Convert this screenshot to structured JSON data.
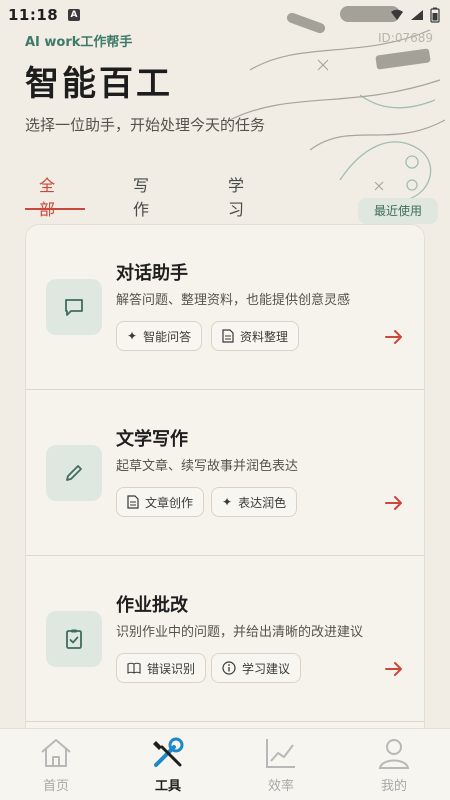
{
  "status_bar": {
    "time": "11:18",
    "a_icon": "A"
  },
  "app_tag": "AI work工作帮手",
  "device_id": "ID:07689",
  "title": "智能百工",
  "subtitle": "选择一位助手，开始处理今天的任务",
  "tabs": [
    {
      "label": "全部",
      "active": true
    },
    {
      "label": "写作",
      "active": false
    },
    {
      "label": "学习",
      "active": false
    }
  ],
  "cards": [
    {
      "icon": "chat-icon",
      "title": "对话助手",
      "desc": "解答问题、整理资料，也能提供创意灵感",
      "chips": [
        {
          "icon": "sparkle-icon",
          "label": "智能问答"
        },
        {
          "icon": "document-icon",
          "label": "资料整理"
        }
      ],
      "badge": ""
    },
    {
      "icon": "pencil-icon",
      "title": "文学写作",
      "desc": "起草文章、续写故事并润色表达",
      "chips": [
        {
          "icon": "document-icon",
          "label": "文章创作"
        },
        {
          "icon": "sparkle-icon",
          "label": "表达润色"
        }
      ],
      "badge": "最近使用"
    },
    {
      "icon": "clipboard-check-icon",
      "title": "作业批改",
      "desc": "识别作业中的问题，并给出清晰的改进建议",
      "chips": [
        {
          "icon": "book-icon",
          "label": "错误识别"
        },
        {
          "icon": "info-icon",
          "label": "学习建议"
        }
      ],
      "badge": ""
    }
  ],
  "bottom_nav": [
    {
      "icon": "home-icon",
      "label": "首页",
      "active": false
    },
    {
      "icon": "tools-icon",
      "label": "工具",
      "active": true
    },
    {
      "icon": "chart-icon",
      "label": "效率",
      "active": false
    },
    {
      "icon": "user-icon",
      "label": "我的",
      "active": false
    }
  ],
  "colors": {
    "accent": "#c9473b",
    "brand_green": "#3e7a68",
    "background": "#f1ede4"
  }
}
